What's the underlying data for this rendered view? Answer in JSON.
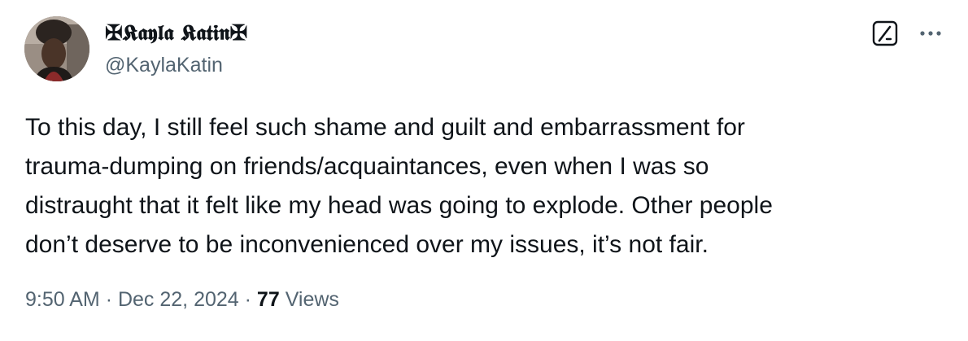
{
  "author": {
    "display_name": "✠𝕶𝖆𝖞𝖑𝖆 𝕶𝖆𝖙𝖎𝖓✠",
    "handle": "@KaylaKatin"
  },
  "tweet": {
    "text_lines": [
      "To this day, I still feel such shame and guilt and embarrassment for",
      "trauma-dumping on friends/acquaintances, even when I was so",
      "distraught that it felt like my head was going to explode. Other people",
      "don’t deserve to be inconvenienced over my issues, it’s not fair."
    ]
  },
  "meta": {
    "time": "9:50 AM",
    "separator": "·",
    "date": "Dec 22, 2024",
    "views_count": "77",
    "views_label": "Views"
  },
  "icons": {
    "grok": "grok-icon",
    "more": "more-icon"
  },
  "colors": {
    "text_primary": "#0f1419",
    "text_secondary": "#536471"
  }
}
